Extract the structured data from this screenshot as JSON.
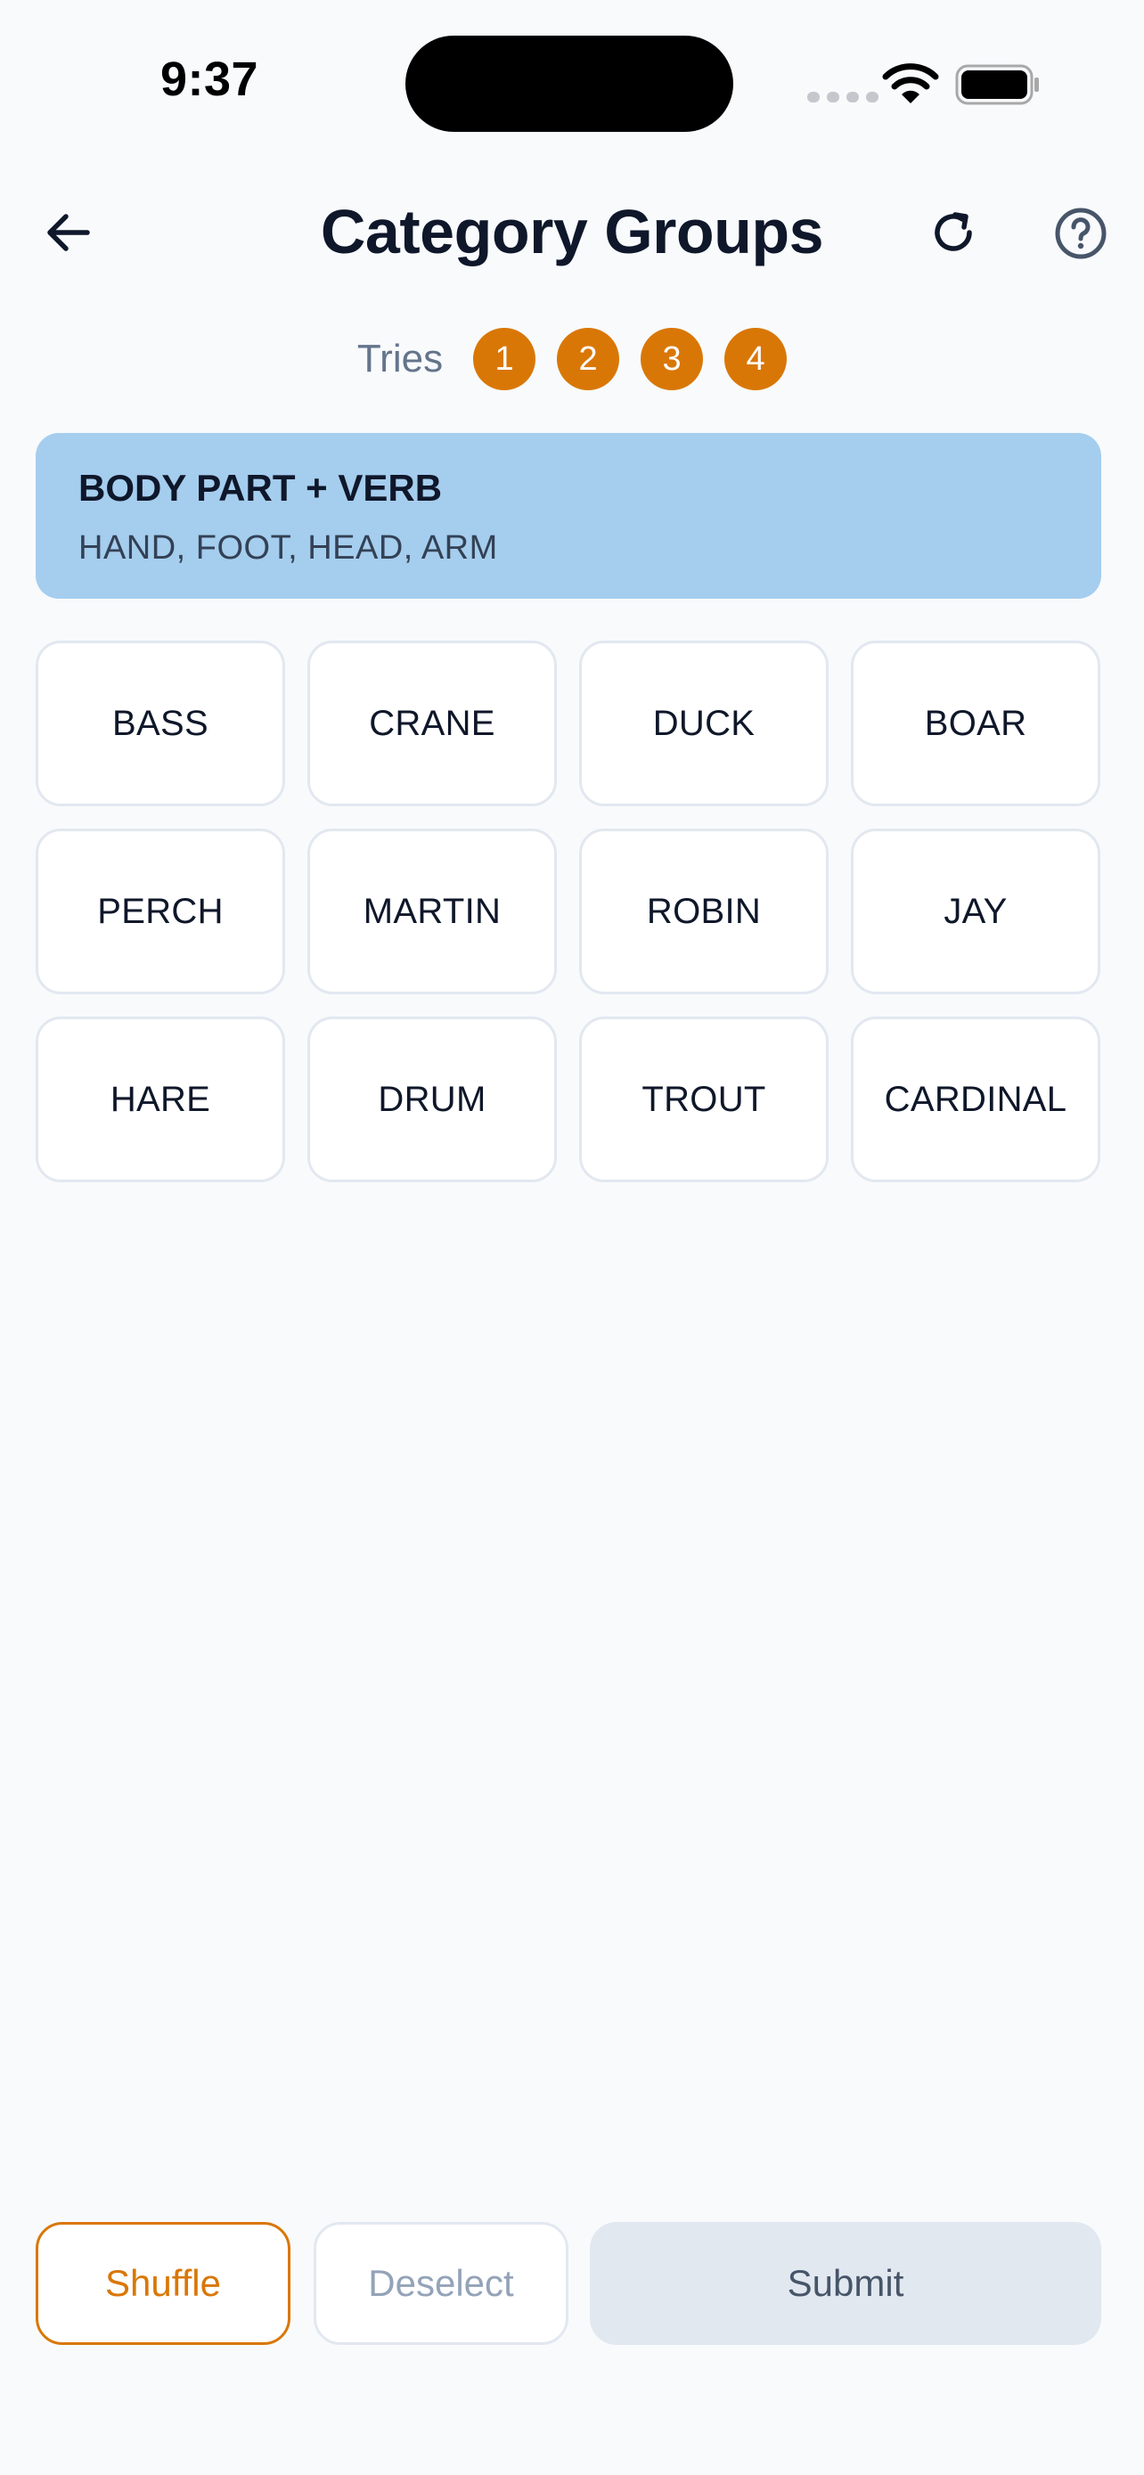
{
  "status_bar": {
    "time": "9:37",
    "icons": [
      "signal-icon",
      "wifi-icon",
      "battery-icon"
    ]
  },
  "header": {
    "title": "Category Groups",
    "back_icon": "arrow-left-icon",
    "refresh_icon": "refresh-icon",
    "help_icon": "question-circle-icon"
  },
  "tries": {
    "label": "Tries",
    "items": [
      "1",
      "2",
      "3",
      "4"
    ]
  },
  "solved_groups": [
    {
      "title": "BODY PART + VERB",
      "words": "HAND, FOOT, HEAD, ARM",
      "color": "#a5cdee"
    }
  ],
  "tiles": [
    "BASS",
    "CRANE",
    "DUCK",
    "BOAR",
    "PERCH",
    "MARTIN",
    "ROBIN",
    "JAY",
    "HARE",
    "DRUM",
    "TROUT",
    "CARDINAL"
  ],
  "actions": {
    "shuffle": "Shuffle",
    "deselect": "Deselect",
    "submit": "Submit"
  },
  "colors": {
    "accent": "#d97706",
    "background": "#f8fafc",
    "tile_border": "#e2e8f0",
    "text": "#0f172a"
  }
}
